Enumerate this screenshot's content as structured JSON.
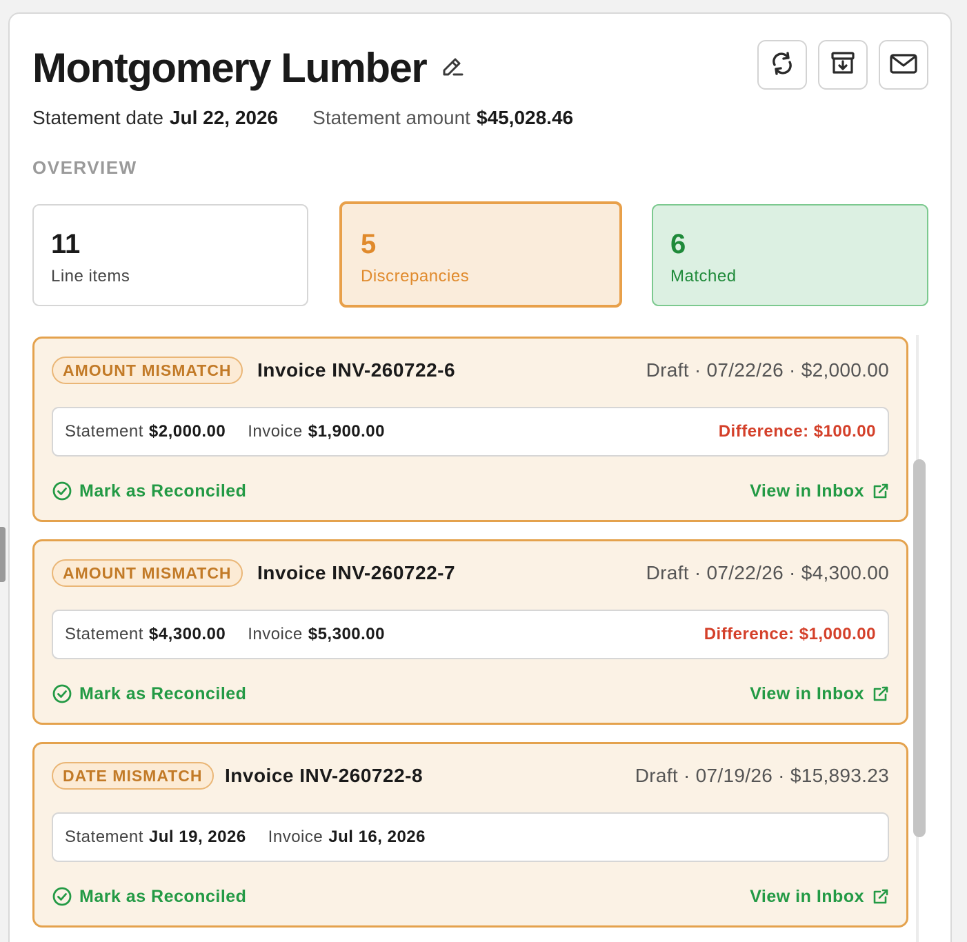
{
  "header": {
    "title": "Montgomery Lumber",
    "statement_date_label": "Statement date",
    "statement_date": "Jul 22, 2026",
    "statement_amount_label": "Statement amount",
    "statement_amount": "$45,028.46"
  },
  "toolbar": {
    "edit_icon": "pencil-icon",
    "refresh_icon": "refresh-icon",
    "archive_icon": "archive-download-icon",
    "email_icon": "mail-icon"
  },
  "overview": {
    "label": "OVERVIEW",
    "line_items": {
      "count": "11",
      "caption": "Line items"
    },
    "discrepancies": {
      "count": "5",
      "caption": "Discrepancies"
    },
    "matched": {
      "count": "6",
      "caption": "Matched"
    }
  },
  "colors": {
    "accent_orange": "#e08a2c",
    "card_border": "#e4a24d",
    "card_bg": "#fbf2e5",
    "success_green": "#239a45",
    "difference_red": "#d4402a"
  },
  "discrepancies": [
    {
      "tag": "AMOUNT MISMATCH",
      "title": "Invoice INV-260722-6",
      "meta": "Draft · 07/22/26 · $2,000.00",
      "statement_label": "Statement",
      "statement_value": "$2,000.00",
      "invoice_label": "Invoice",
      "invoice_value": "$1,900.00",
      "difference": "Difference: $100.00",
      "reconcile_label": "Mark as Reconciled",
      "inbox_label": "View in Inbox"
    },
    {
      "tag": "AMOUNT MISMATCH",
      "title": "Invoice INV-260722-7",
      "meta": "Draft · 07/22/26 · $4,300.00",
      "statement_label": "Statement",
      "statement_value": "$4,300.00",
      "invoice_label": "Invoice",
      "invoice_value": "$5,300.00",
      "difference": "Difference: $1,000.00",
      "reconcile_label": "Mark as Reconciled",
      "inbox_label": "View in Inbox"
    },
    {
      "tag": "DATE MISMATCH",
      "title": "Invoice INV-260722-8",
      "meta": "Draft · 07/19/26 · $15,893.23",
      "statement_label": "Statement",
      "statement_value": "Jul 19, 2026",
      "invoice_label": "Invoice",
      "invoice_value": "Jul 16, 2026",
      "difference": "",
      "reconcile_label": "Mark as Reconciled",
      "inbox_label": "View in Inbox"
    }
  ]
}
